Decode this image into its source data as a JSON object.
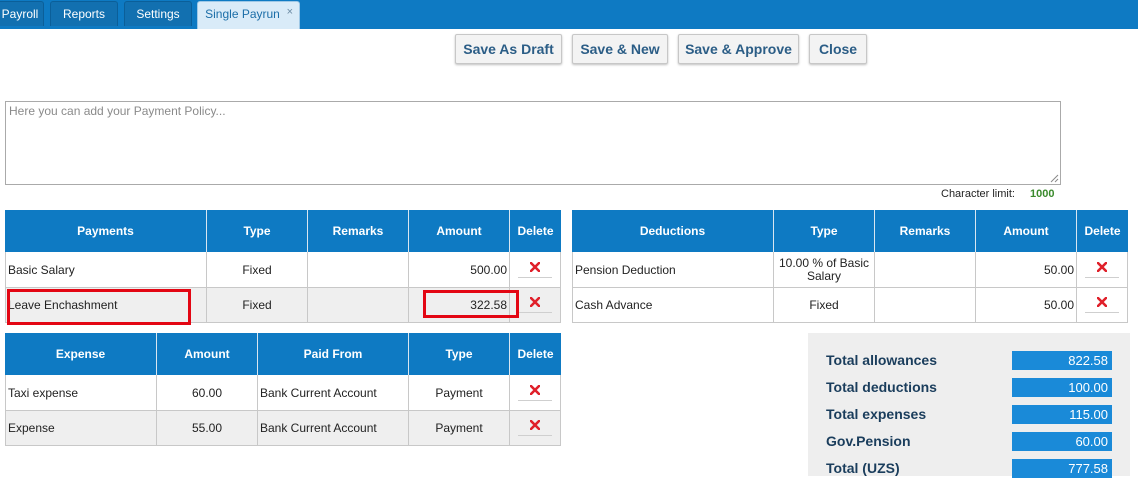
{
  "tabs": [
    {
      "label": "Payroll"
    },
    {
      "label": "Reports"
    },
    {
      "label": "Settings"
    },
    {
      "label": "Single Payrun",
      "close": "×"
    }
  ],
  "actions": {
    "save_draft": "Save As Draft",
    "save_new": "Save & New",
    "save_approve": "Save & Approve",
    "close": "Close"
  },
  "policy": {
    "placeholder": "Here you can add your Payment Policy...",
    "char_limit_label": "Character limit:",
    "char_limit_value": "1000"
  },
  "payments": {
    "headers": [
      "Payments",
      "Type",
      "Remarks",
      "Amount",
      "Delete"
    ],
    "rows": [
      {
        "name": "Basic Salary",
        "type": "Fixed",
        "remarks": "",
        "amount": "500.00"
      },
      {
        "name": "Leave Enchashment",
        "type": "Fixed",
        "remarks": "",
        "amount": "322.58"
      }
    ]
  },
  "deductions": {
    "headers": [
      "Deductions",
      "Type",
      "Remarks",
      "Amount",
      "Delete"
    ],
    "rows": [
      {
        "name": "Pension Deduction",
        "type_line1": "10.00 % of Basic",
        "type_line2": "Salary",
        "remarks": "",
        "amount": "50.00"
      },
      {
        "name": "Cash Advance",
        "type": "Fixed",
        "remarks": "",
        "amount": "50.00"
      }
    ]
  },
  "expenses": {
    "headers": [
      "Expense",
      "Amount",
      "Paid From",
      "Type",
      "Delete"
    ],
    "rows": [
      {
        "name": "Taxi expense",
        "amount": "60.00",
        "paid_from": "Bank Current Account",
        "type": "Payment"
      },
      {
        "name": "Expense",
        "amount": "55.00",
        "paid_from": "Bank Current Account",
        "type": "Payment"
      }
    ]
  },
  "totals": [
    {
      "label": "Total allowances",
      "value": "822.58"
    },
    {
      "label": "Total deductions",
      "value": "100.00"
    },
    {
      "label": "Total expenses",
      "value": "115.00"
    },
    {
      "label": "Gov.Pension",
      "value": "60.00"
    },
    {
      "label": "Total (UZS)",
      "value": "777.58"
    }
  ],
  "colors": {
    "header_blue": "#0e7ac3",
    "total_value_blue": "#1a8ad8",
    "delete_red": "#e0202a",
    "highlight_red": "#e30613"
  },
  "icons": {
    "delete": "delete-x-icon",
    "resize": "resize-grip-icon"
  }
}
